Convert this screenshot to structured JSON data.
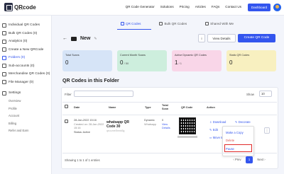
{
  "brand": {
    "name": "QRcode",
    "sub": "Chimp"
  },
  "nav": [
    "QR Code Generator",
    "Solutions",
    "Pricing",
    "Articles",
    "FAQs",
    "Contact Us"
  ],
  "dashboard_label": "Dashboard",
  "sidebar": {
    "items": [
      {
        "label": "Individual QR Codes"
      },
      {
        "label": "Bulk QR Codes (0)"
      },
      {
        "label": "Analytics (0)"
      },
      {
        "label": "Create a New QRCode"
      },
      {
        "label": "Folders (0)"
      },
      {
        "label": "Sub-accounts (0)"
      },
      {
        "label": "Merchandise QR Codes (0)"
      },
      {
        "label": "File Manager (0)"
      },
      {
        "label": "Settings"
      }
    ],
    "settings_sub": [
      "Overview",
      "Profile",
      "Account",
      "Billing",
      "Refer and Earn"
    ]
  },
  "tabs": [
    "QR Codes",
    "Bulk QR Codes",
    "Shared With Me"
  ],
  "folder": {
    "back": "←",
    "name": "New",
    "edit": "✎"
  },
  "toolbar": {
    "info": "i",
    "view_details": "View Details",
    "create": "Create QR Code"
  },
  "stats": [
    {
      "label": "Total Scans",
      "value": "0",
      "suffix": "",
      "color": "#d6e4f7"
    },
    {
      "label": "Current Month Scans",
      "value": "0",
      "suffix": " / 50",
      "color": "#cdeedd"
    },
    {
      "label": "Active Dynamic QR Codes",
      "value": "1",
      "suffix": " / 1",
      "color": "#f9d6e8"
    },
    {
      "label": "Static QR Codes",
      "value": "0",
      "suffix": "",
      "color": "#f8f0c0"
    }
  ],
  "section_title": "QR Codes in this Folder",
  "table": {
    "filter_label": "Filter",
    "show_label": "Show",
    "show_value": "10",
    "headers": {
      "date": "Date",
      "name": "Name",
      "type": "Type",
      "scans": "Total Scan",
      "qr": "QR Code",
      "action": "Action"
    },
    "row": {
      "created": "28-Jan-2022 15:16",
      "updated": "Created on: 28-Jan-2022 15:16",
      "status": "Status: Active",
      "name": "whatsapp QR Code 30",
      "url": "qrco.me/5mnb3g",
      "type": "Dynamic",
      "type_sub": "Whatsapp",
      "scans": "0",
      "scans_sub": "View Details",
      "actions": {
        "download": "Download",
        "decorate": "Decorate",
        "edit": "Edit",
        "move": "Move to",
        "more": "⋮"
      }
    }
  },
  "dropdown": [
    "Make a Copy",
    "Delete",
    "Pause"
  ],
  "footer": {
    "showing": "Showing 1 to 1 of 1 entries",
    "prev": "Prev",
    "page": "1",
    "next": "Next"
  }
}
